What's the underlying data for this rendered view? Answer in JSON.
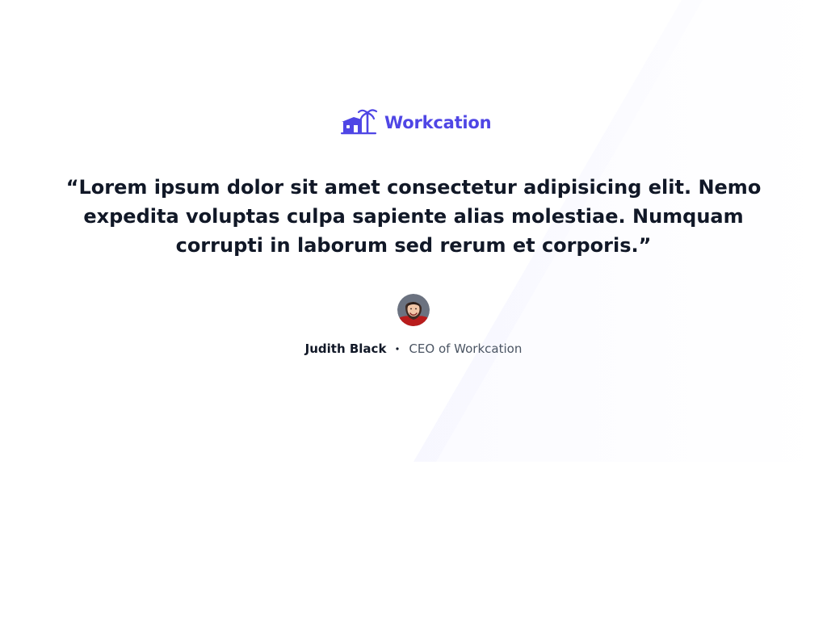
{
  "brand": {
    "name": "Workcation",
    "accent_color": "#4f46e5",
    "logo_icon": "workcation-logo-icon"
  },
  "testimonial": {
    "quote": "“Lorem ipsum dolor sit amet consectetur adipisicing elit. Nemo expedita voluptas culpa sapiente alias molestiae. Numquam corrupti in laborum sed rerum et corporis.”",
    "author_name": "Judith Black",
    "author_role": "CEO of Workcation",
    "avatar_icon": "avatar"
  },
  "colors": {
    "text_primary": "#111827",
    "text_secondary": "#4b5563"
  }
}
